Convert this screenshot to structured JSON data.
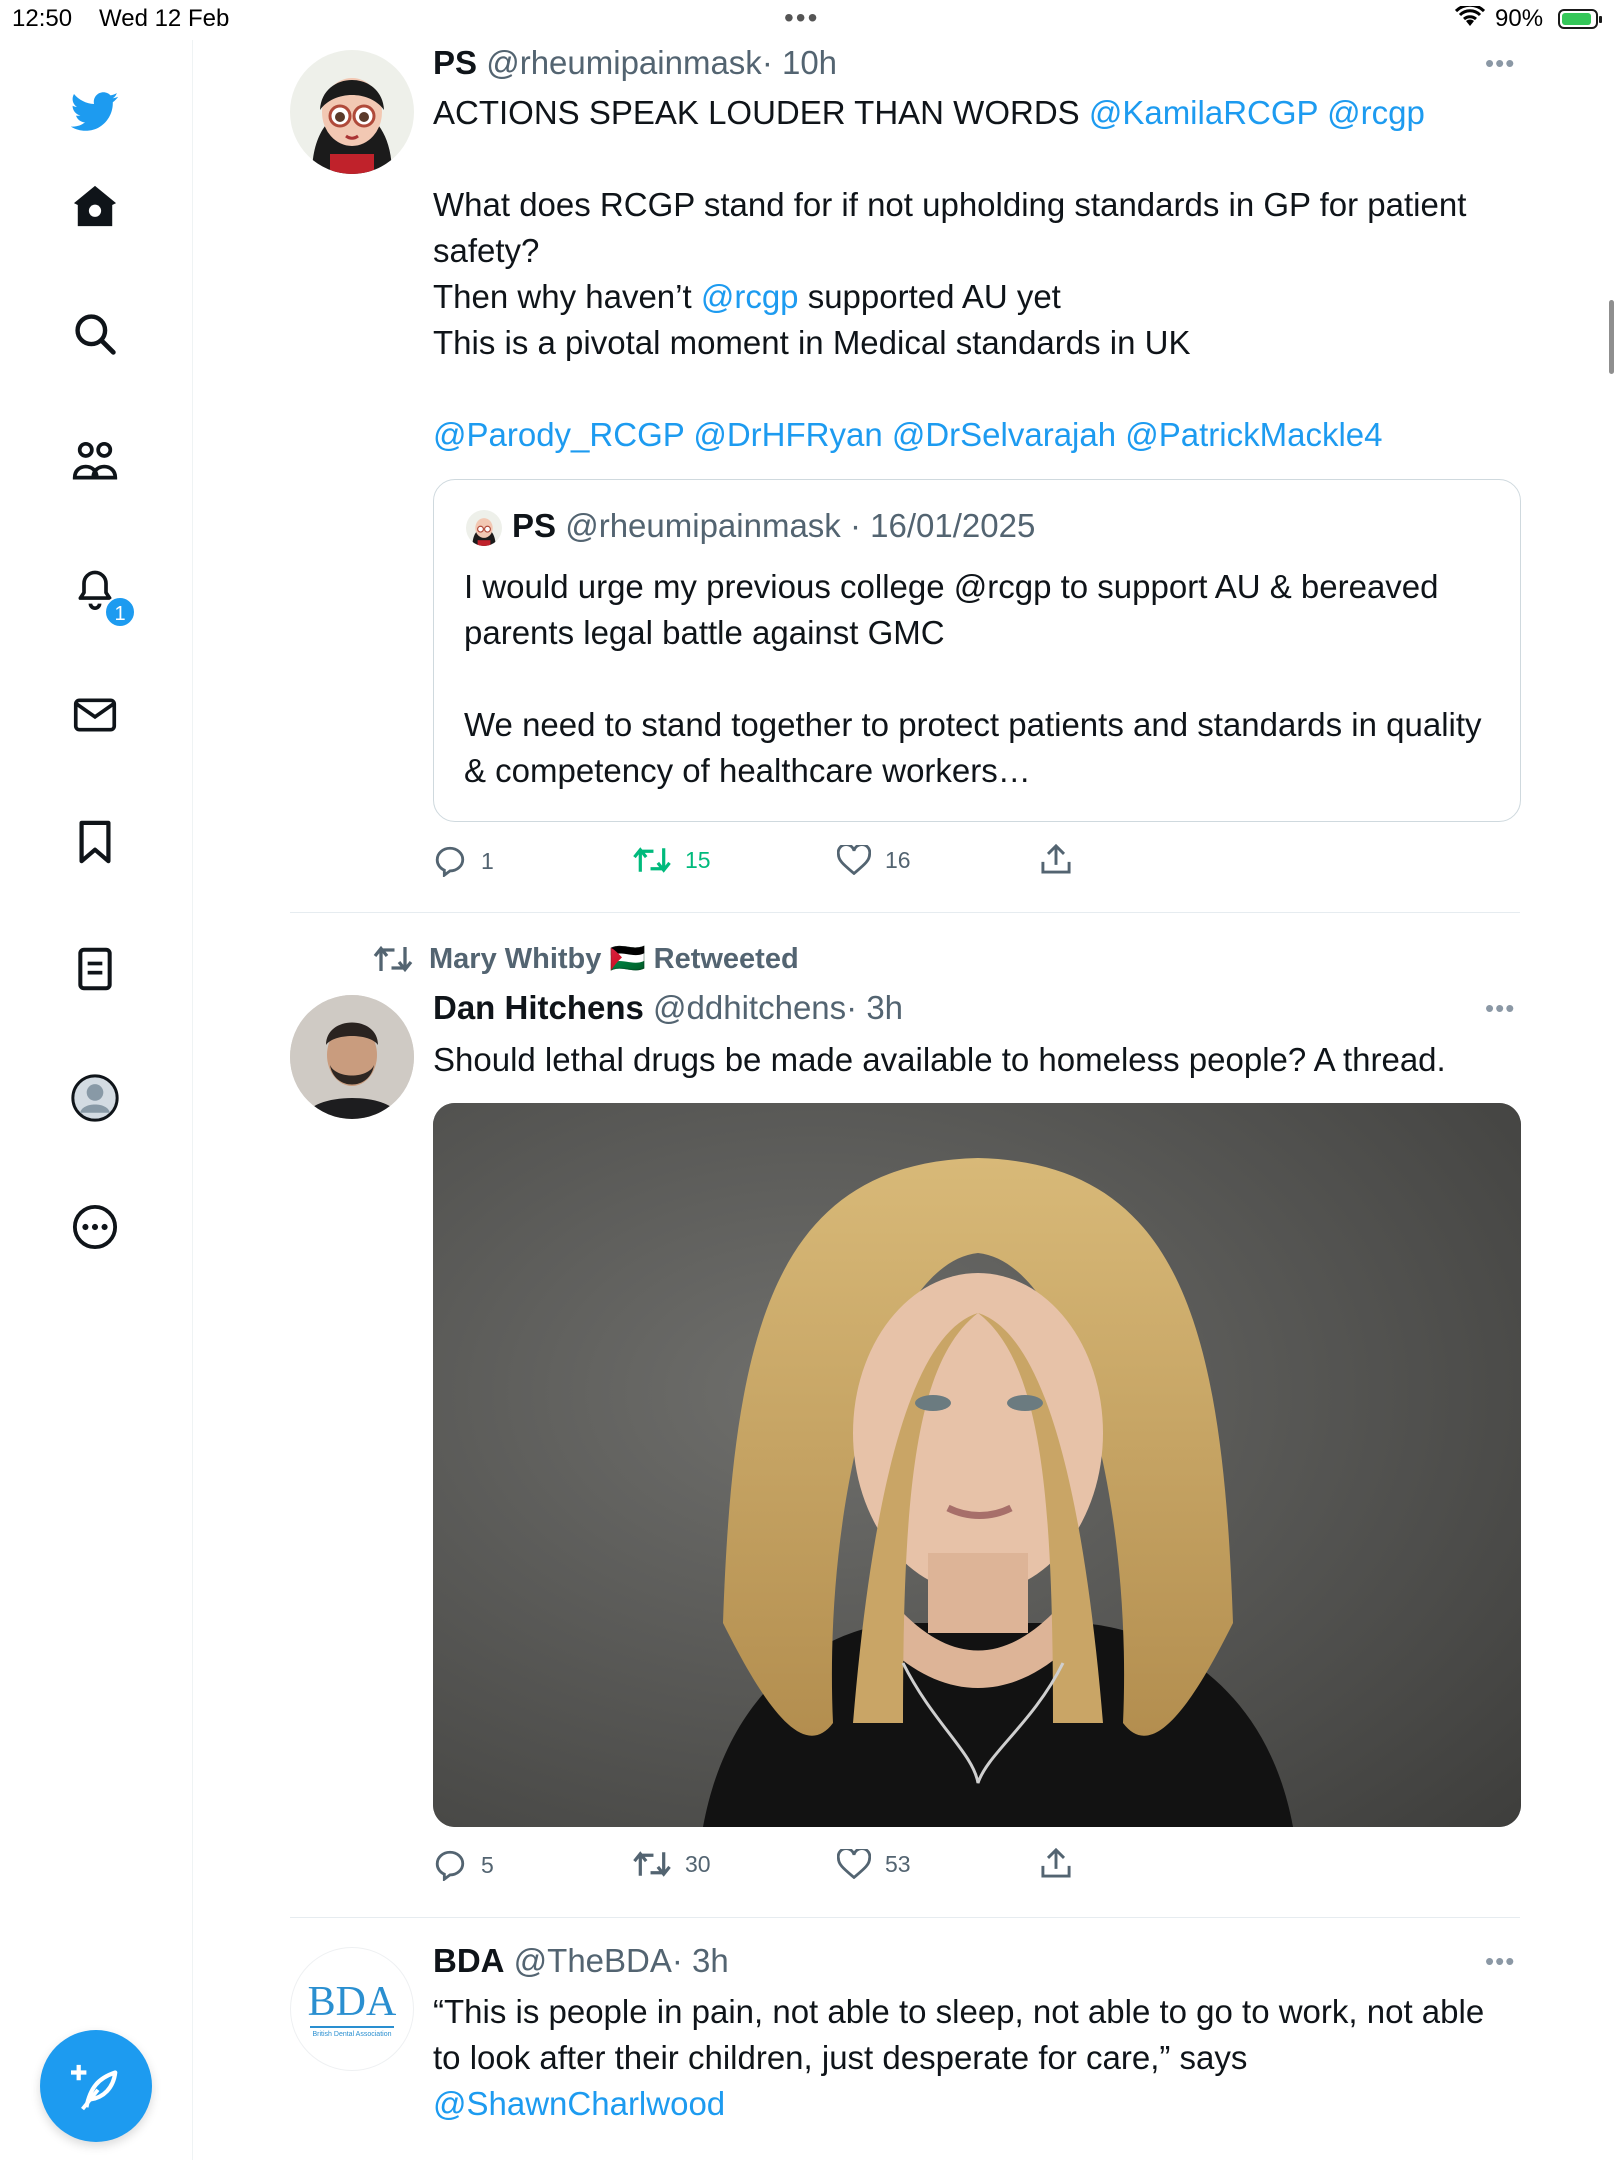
{
  "status_bar": {
    "time": "12:50",
    "date": "Wed 12 Feb",
    "battery": "90%",
    "battery_level": 0.9
  },
  "colors": {
    "accent": "#1d9bf0",
    "retweet_active": "#00ba7c",
    "muted": "#536471"
  },
  "sidebar": {
    "items": [
      {
        "name": "twitter-logo-icon"
      },
      {
        "name": "home-icon"
      },
      {
        "name": "explore-search-icon"
      },
      {
        "name": "communities-icon"
      },
      {
        "name": "notifications-bell-icon"
      },
      {
        "name": "messages-envelope-icon"
      },
      {
        "name": "bookmarks-icon"
      },
      {
        "name": "lists-icon"
      },
      {
        "name": "profile-icon"
      },
      {
        "name": "more-options-icon"
      }
    ],
    "notification_count": "1"
  },
  "tweets": [
    {
      "display_name": "PS",
      "handle": "@rheumipainmask",
      "time": "· 10h",
      "line1": "ACTIONS SPEAK LOUDER THAN WORDS ",
      "line1_mentions": "@KamilaRCGP @rcgp",
      "para2_a": "What does RCGP stand for if not upholding standards in GP for patient safety?",
      "para2_b_pre": "Then why haven’t ",
      "para2_b_mention": "@rcgp",
      "para2_b_post": " supported AU yet",
      "para2_c": "This is a pivotal moment in Medical standards in UK",
      "mentions_line": "@Parody_RCGP @DrHFRyan @DrSelvarajah @PatrickMackle4",
      "quote": {
        "display_name": "PS",
        "handle": "@rheumipainmask",
        "date": "· 16/01/2025",
        "para1": "I would urge my previous college @rcgp  to support AU & bereaved parents legal battle against GMC",
        "para2": "We need to stand together to protect patients and standards in quality & competency of healthcare workers…"
      },
      "replies": "1",
      "retweets": "15",
      "likes": "16"
    },
    {
      "retweeted_by": "Mary Whitby 🇵🇸 Retweeted",
      "display_name": "Dan Hitchens",
      "handle": "@ddhitchens",
      "time": "· 3h",
      "text": "Should lethal drugs be made available to homeless people? A thread.",
      "replies": "5",
      "retweets": "30",
      "likes": "53"
    },
    {
      "display_name": "BDA",
      "handle": "@TheBDA",
      "time": "· 3h",
      "avatar_text": "BDA",
      "avatar_subtext": "British Dental Association",
      "text_a": "“This is people in pain, not able to sleep, not able to go to work, not able to look after their children, just desperate for care,” says",
      "text_mention": "@ShawnCharlwood"
    }
  ]
}
